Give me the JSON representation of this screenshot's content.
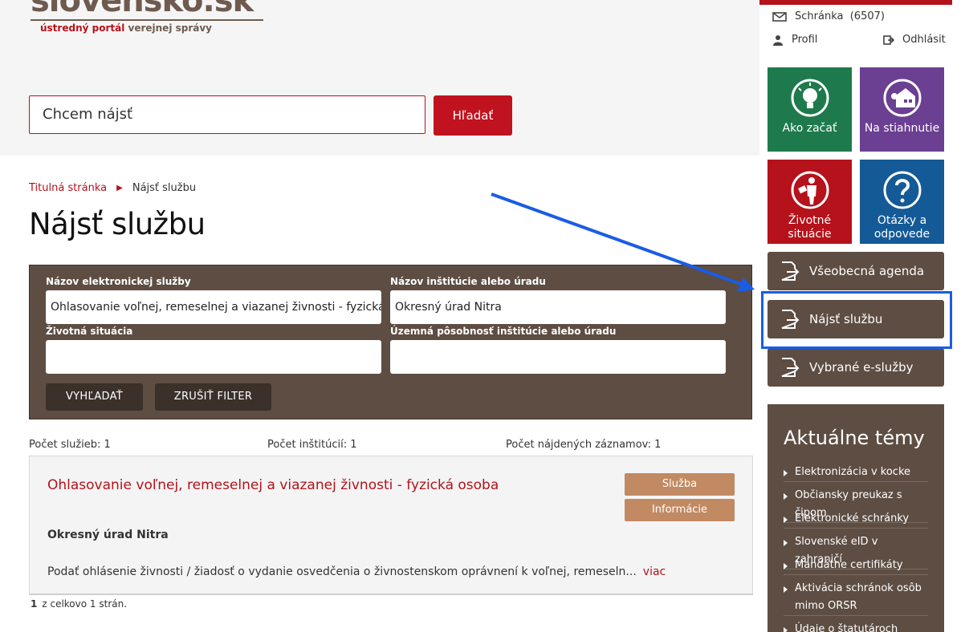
{
  "header": {
    "logo_text": "slovensko.sk",
    "logo_subtitle": "ústredný portál",
    "logo_subtitle_bold": "verejnej správy",
    "search_placeholder": "Chcem nájsť",
    "search_button": "Hľadať"
  },
  "breadcrumb": {
    "home": "Titulná stránka",
    "current": "Nájsť službu"
  },
  "page_title": "Nájsť službu",
  "filter": {
    "service_name_label": "Názov elektronickej služby",
    "service_name_value": "Ohlasovanie voľnej, remeselnej a viazanej živnosti - fyzická osoba",
    "institution_label": "Názov inštitúcie alebo úradu",
    "institution_value": "Okresný úrad Nitra",
    "life_situation_label": "Životná situácia",
    "life_situation_value": "",
    "territorial_label": "Územná pôsobnosť inštitúcie alebo úradu",
    "territorial_value": "",
    "search_button": "VYHĽADAŤ",
    "clear_button": "ZRUŠIŤ FILTER"
  },
  "counts": {
    "services": "Počet služieb: 1",
    "institutions": "Počet inštitúcií: 1",
    "records": "Počet nájdených záznamov: 1"
  },
  "result": {
    "title": "Ohlasovanie voľnej, remeselnej a viazanej živnosti - fyzická osoba",
    "service_button": "Služba",
    "info_button": "Informácie",
    "organization": "Okresný úrad Nitra",
    "description": "Podať ohlásenie živnosti / žiadosť o vydanie osvedčenia o živnostenskom oprávnení k voľnej, remeseln...",
    "more_link": "viac"
  },
  "pager": {
    "current_page": "1",
    "total_text": "z celkovo 1 strán."
  },
  "sidebar": {
    "mailbox_label": "Schránka",
    "mailbox_count": "(6507)",
    "profile_label": "Profil",
    "logout_label": "Odhlásit",
    "tiles": [
      {
        "label": "Ako začať",
        "color": "#1e7a4c",
        "icon": "lightbulb-icon"
      },
      {
        "label": "Na stiahnutie",
        "color": "#6b3f91",
        "icon": "house-icon"
      },
      {
        "label": "Životné situácie",
        "color": "#b5121b",
        "icon": "person-icon"
      },
      {
        "label": "Otázky a odpovede",
        "color": "#145a96",
        "icon": "question-icon"
      }
    ],
    "nav": [
      {
        "label": "Všeobecná agenda"
      },
      {
        "label": "Nájsť službu"
      },
      {
        "label": "Vybrané e-služby"
      }
    ],
    "topics_title": "Aktuálne témy",
    "topics": [
      "Elektronizácia v kocke",
      "Občiansky preukaz s čipom",
      "Elektronické schránky",
      "Slovenské eID v zahraničí",
      "Mandátne certifikáty",
      "Aktivácia schránok osôb mimo ORSR",
      "Údaje o štatutároch"
    ]
  },
  "colors": {
    "brand_red": "#b5121b",
    "brown": "#5d4d43",
    "tan": "#c18a63",
    "annotation_blue": "#1a5ce6"
  }
}
